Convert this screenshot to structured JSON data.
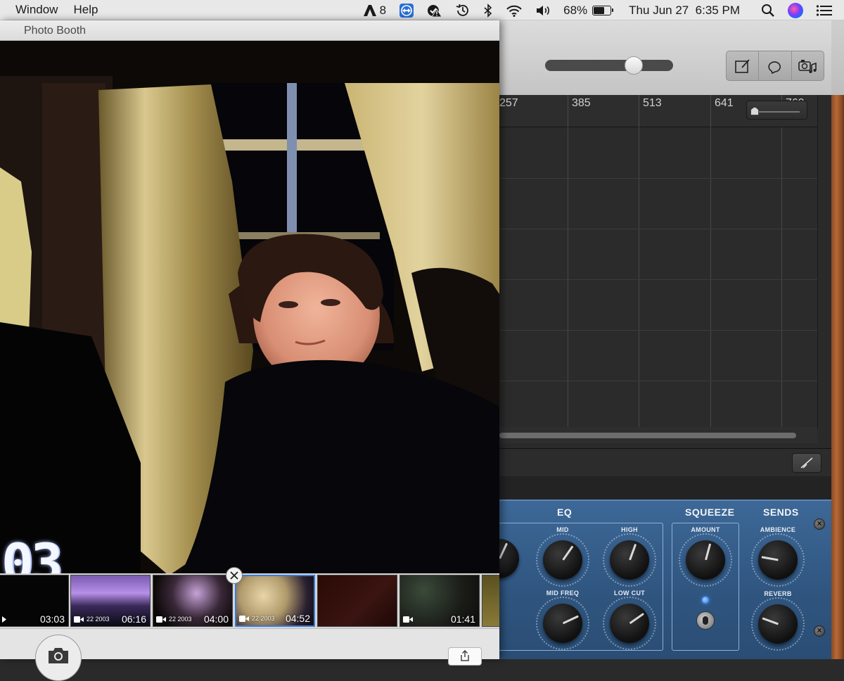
{
  "menubar": {
    "menus": [
      "Window",
      "Help"
    ],
    "adobe_badge": "8",
    "battery_percent": "68%",
    "battery_level": 0.68,
    "datetime": "Thu Jun 27  6:35 PM"
  },
  "photobooth": {
    "window_title": "Photo Booth",
    "timecode_overlay": "03",
    "thumbnails": [
      {
        "duration": "03:03",
        "date": ""
      },
      {
        "duration": "06:16",
        "date": "22 2003"
      },
      {
        "duration": "04:00",
        "date": "22 2003"
      },
      {
        "duration": "04:52",
        "date": "22 2003",
        "selected": true
      },
      {
        "duration": "",
        "date": ""
      },
      {
        "duration": "01:41",
        "date": ""
      }
    ]
  },
  "garageband": {
    "ruler_ticks": [
      "257",
      "385",
      "513",
      "641",
      "769"
    ],
    "plugin": {
      "sections": {
        "eq": "EQ",
        "squeeze": "SQUEEZE",
        "sends": "SENDS"
      },
      "knobs": {
        "mid": "MID",
        "high": "HIGH",
        "mid_freq": "MID FREQ",
        "low_cut": "LOW CUT",
        "amount": "AMOUNT",
        "ambience": "AMBIENCE",
        "reverb": "REVERB"
      }
    }
  },
  "colors": {
    "menubar_bg": "#e9e8e9",
    "plugin_blue": "#2f557f",
    "selection_blue": "#3a7bd8"
  }
}
